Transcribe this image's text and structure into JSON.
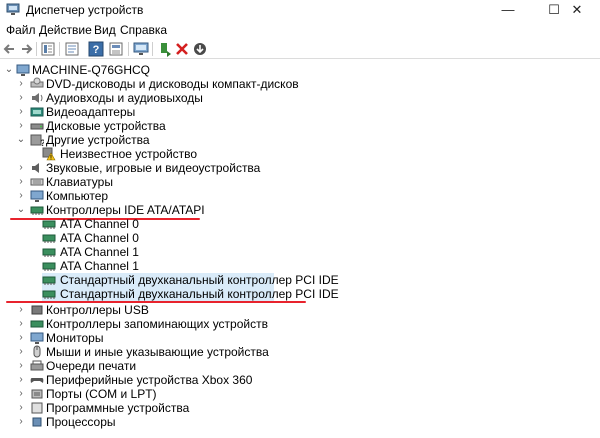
{
  "window": {
    "title": "Диспетчер устройств"
  },
  "window_controls": {
    "minimize": "—",
    "maximize": "☐",
    "close": "✕"
  },
  "menu": [
    "Файл",
    "Действие",
    "Вид",
    "Справка"
  ],
  "toolbar": {
    "buttons": [
      "back-icon",
      "forward-icon",
      "properties-icon",
      "refresh-icon",
      "help-icon",
      "view-icon",
      "scan-hardware-icon",
      "update-driver-icon",
      "uninstall-icon",
      "download-icon"
    ]
  },
  "tree": {
    "root": "MACHINE-Q76GHCQ",
    "items": [
      {
        "label": "DVD-дисководы и дисководы компакт-дисков",
        "expanded": false
      },
      {
        "label": "Аудиовходы и аудиовыходы",
        "expanded": false
      },
      {
        "label": "Видеоадаптеры",
        "expanded": false
      },
      {
        "label": "Дисковые устройства",
        "expanded": false
      },
      {
        "label": "Другие устройства",
        "expanded": true
      },
      {
        "label": "Неизвестное устройство",
        "child": true
      },
      {
        "label": "Звуковые, игровые и видеоустройства",
        "expanded": false
      },
      {
        "label": "Клавиатуры",
        "expanded": false
      },
      {
        "label": "Компьютер",
        "expanded": false
      },
      {
        "label": "Контроллеры IDE ATA/ATAPI",
        "expanded": true
      },
      {
        "label": "ATA Channel 0",
        "child": true
      },
      {
        "label": "ATA Channel 0",
        "child": true
      },
      {
        "label": "ATA Channel 1",
        "child": true
      },
      {
        "label": "ATA Channel 1",
        "child": true
      },
      {
        "label": "Стандартный двухканальный контроллер PCI IDE",
        "child": true,
        "selected": true
      },
      {
        "label": "Стандартный двухканальный контроллер PCI IDE",
        "child": true,
        "selected": true
      },
      {
        "label": "Контроллеры USB",
        "expanded": false
      },
      {
        "label": "Контроллеры запоминающих устройств",
        "expanded": false
      },
      {
        "label": "Мониторы",
        "expanded": false
      },
      {
        "label": "Мыши и иные указывающие устройства",
        "expanded": false
      },
      {
        "label": "Очереди печати",
        "expanded": false
      },
      {
        "label": "Периферийные устройства Xbox 360",
        "expanded": false
      },
      {
        "label": "Порты (COM и LPT)",
        "expanded": false
      },
      {
        "label": "Программные устройства",
        "expanded": false
      },
      {
        "label": "Процессоры",
        "expanded": false
      }
    ]
  },
  "colors": {
    "selection": "#d9ebf9",
    "annotation": "#e8232d"
  }
}
